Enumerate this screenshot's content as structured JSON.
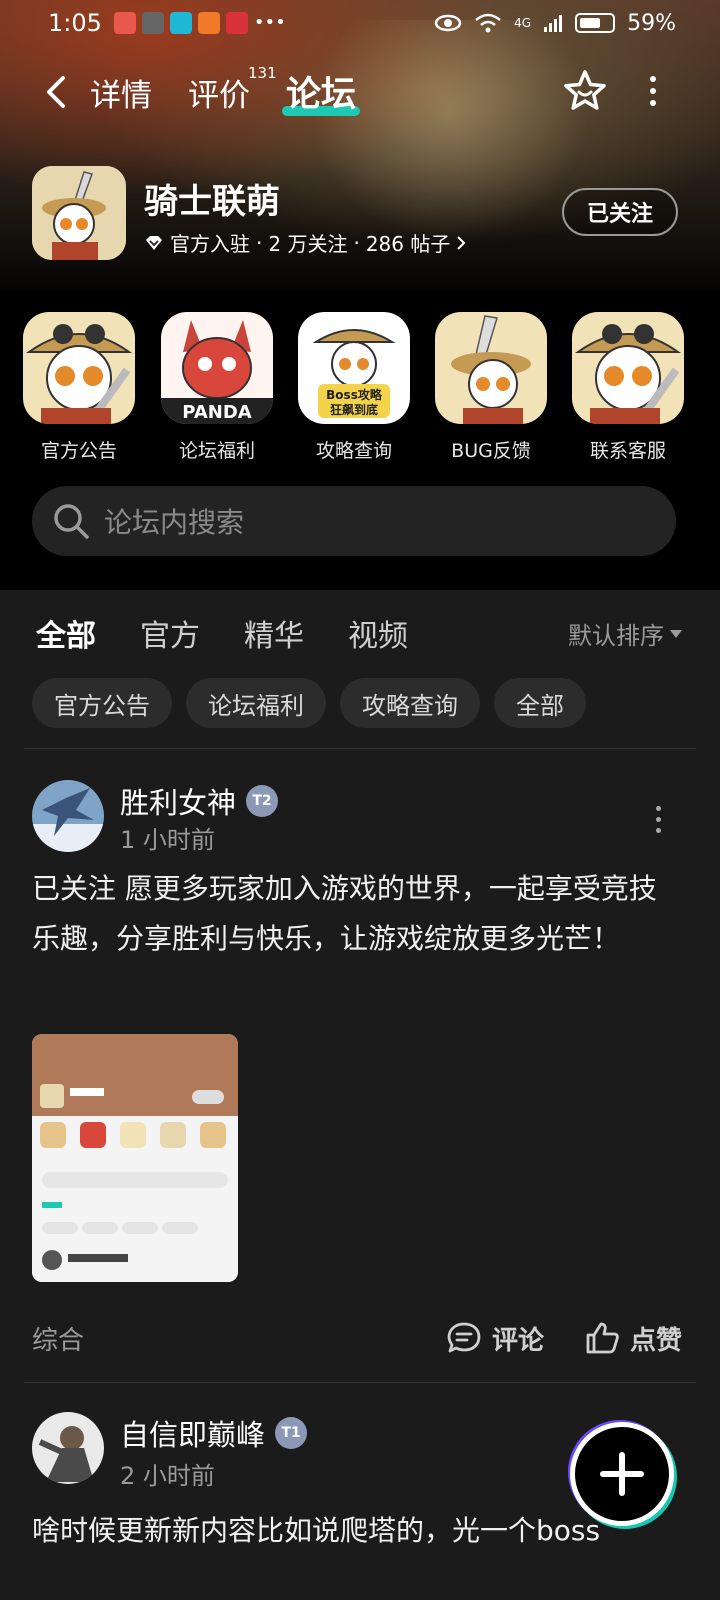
{
  "status_bar": {
    "time": "1:05",
    "network_label": "4G",
    "battery_percent": "59%"
  },
  "nav": {
    "tabs": [
      {
        "label": "详情"
      },
      {
        "label": "评价",
        "badge": "131"
      },
      {
        "label": "论坛"
      }
    ],
    "active_tab": "论坛"
  },
  "game": {
    "title": "骑士联萌",
    "official_label": "官方入驻",
    "followers": "2 万关注",
    "posts": "286 帖子",
    "follow_button": "已关注"
  },
  "shortcuts": [
    {
      "label": "官方公告",
      "icon": "panda-knight-icon"
    },
    {
      "label": "论坛福利",
      "icon": "panda-dragon-icon"
    },
    {
      "label": "攻略查询",
      "icon": "boss-guide-icon",
      "icon_text": "Boss攻略\n狂飙到底"
    },
    {
      "label": "BUG反馈",
      "icon": "panda-sword-icon"
    },
    {
      "label": "联系客服",
      "icon": "panda-knight-icon"
    }
  ],
  "search": {
    "placeholder": "论坛内搜索"
  },
  "feed_tabs": [
    {
      "label": "全部",
      "active": true
    },
    {
      "label": "官方"
    },
    {
      "label": "精华"
    },
    {
      "label": "视频"
    }
  ],
  "sort_label": "默认排序",
  "chips": [
    {
      "label": "官方公告"
    },
    {
      "label": "论坛福利"
    },
    {
      "label": "攻略查询"
    },
    {
      "label": "全部"
    }
  ],
  "posts": [
    {
      "author": "胜利女神",
      "level": "2",
      "time": "1 小时前",
      "text": "已关注 愿更多玩家加入游戏的世界，一起享受竞技乐趣，分享胜利与快乐，让游戏绽放更多光芒！",
      "category": "综合",
      "comment_label": "评论",
      "like_label": "点赞"
    },
    {
      "author": "自信即巅峰",
      "level": "1",
      "time": "2 小时前",
      "text": "啥时候更新新内容比如说爬塔的，光一个boss"
    }
  ],
  "colors": {
    "accent": "#1ec9b4",
    "background": "#1b1b1b",
    "chip_bg": "#2c2c2c"
  }
}
